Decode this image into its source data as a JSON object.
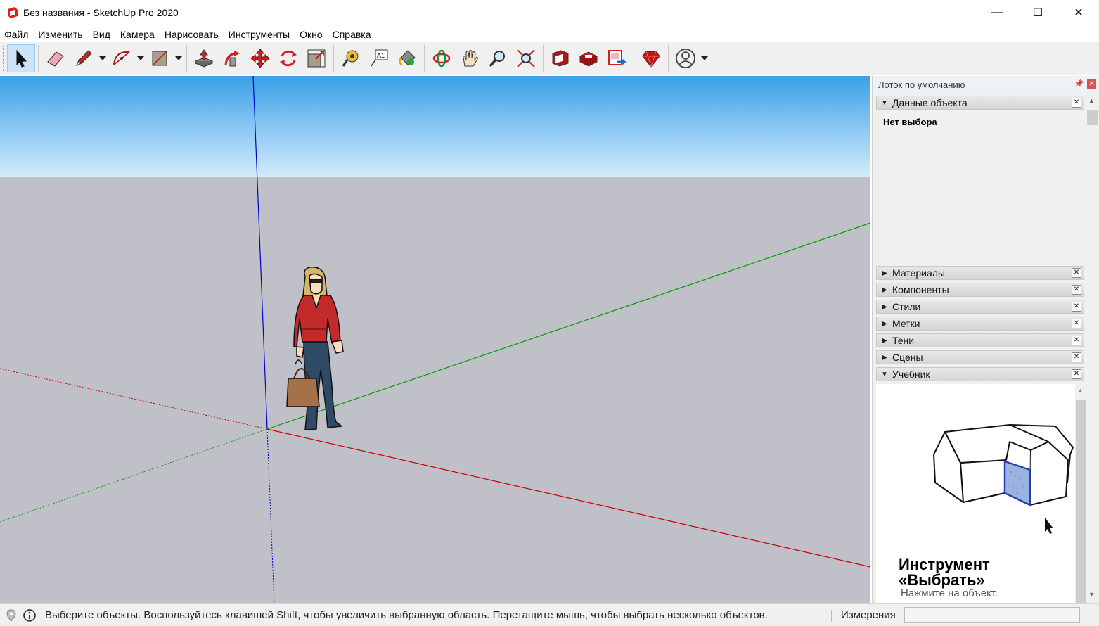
{
  "window": {
    "title": "Без названия - SketchUp Pro 2020",
    "controls": {
      "minimize": "—",
      "maximize": "☐",
      "close": "✕"
    }
  },
  "menu": [
    "Файл",
    "Изменить",
    "Вид",
    "Камера",
    "Нарисовать",
    "Инструменты",
    "Окно",
    "Справка"
  ],
  "toolbar": {
    "tools": [
      "select-icon",
      "eraser-icon",
      "pencil-line-icon",
      "arc-icon",
      "rectangle-icon",
      "push-pull-icon",
      "follow-me-icon",
      "move-icon",
      "rotate-icon",
      "scale-icon",
      "tape-measure-icon",
      "text-icon",
      "paint-bucket-icon",
      "orbit-icon",
      "pan-icon",
      "zoom-icon",
      "zoom-extents-icon",
      "3d-warehouse-icon",
      "extension-warehouse-icon",
      "layout-icon",
      "ruby-icon",
      "account-icon"
    ],
    "selected": "select-icon"
  },
  "tray": {
    "title": "Лоток по умолчанию",
    "entity_info": {
      "header": "Данные объекта",
      "status": "Нет выбора"
    },
    "panels": [
      "Материалы",
      "Компоненты",
      "Стили",
      "Метки",
      "Тени",
      "Сцены",
      "Учебник"
    ],
    "tutorial": {
      "title_line1": "Инструмент",
      "title_line2": "«Выбрать»",
      "subtitle": "Нажмите на объект."
    }
  },
  "status": {
    "message": "Выберите объекты. Воспользуйтесь клавишей Shift, чтобы увеличить выбранную область. Перетащите мышь, чтобы выбрать несколько объектов.",
    "measurements_label": "Измерения",
    "measurements_value": ""
  },
  "colors": {
    "sky_top": "#3aa0e8",
    "sky_bottom": "#d4ecfb",
    "ground": "#c0c0c8",
    "axis_red": "#cc0000",
    "axis_green": "#00a000",
    "axis_blue": "#0000cc",
    "selection_blue": "#cce4f7"
  }
}
